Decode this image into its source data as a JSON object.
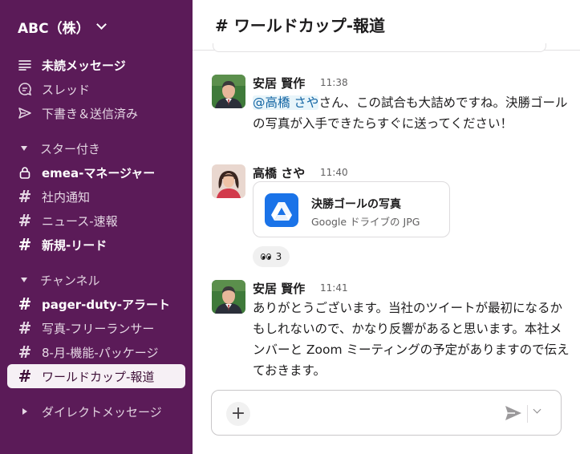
{
  "workspace": {
    "name": "ABC（株）"
  },
  "sidebar": {
    "nav": [
      {
        "label": "未読メッセージ",
        "icon": "unread-lines-icon"
      },
      {
        "label": "スレッド",
        "icon": "thread-bubble-icon"
      },
      {
        "label": "下書き＆送信済み",
        "icon": "send-arrow-icon"
      }
    ],
    "starred_section": "スター付き",
    "starred": [
      {
        "label": "emea-マネージャー",
        "icon": "lock-icon"
      },
      {
        "label": "社内通知",
        "icon": "hash-icon"
      },
      {
        "label": "ニュース-速報",
        "icon": "hash-icon"
      },
      {
        "label": "新規-リード",
        "icon": "hash-icon"
      }
    ],
    "channels_section": "チャンネル",
    "channels": [
      {
        "label": "pager-duty-アラート",
        "icon": "hash-icon"
      },
      {
        "label": "写真-フリーランサー",
        "icon": "hash-icon"
      },
      {
        "label": "8-月-機能-パッケージ",
        "icon": "hash-icon"
      },
      {
        "label": "ワールドカップ-報道",
        "icon": "hash-icon",
        "active": true
      }
    ],
    "dm_section": "ダイレクトメッセージ"
  },
  "header": {
    "hash": "#",
    "channel": "ワールドカップ-報道"
  },
  "messages": [
    {
      "author": "安居 賢作",
      "time": "11:38",
      "mention": "@高橋 さや",
      "text": "さん、この試合も大詰めですね。決勝ゴールの写真が入手できたらすぐに送ってください！"
    },
    {
      "author": "高橋 さや",
      "time": "11:40",
      "file": {
        "name": "決勝ゴールの写真",
        "meta": "Google ドライブの JPG",
        "icon": "google-drive-icon"
      },
      "reaction": {
        "emoji": "eyes",
        "count": "3"
      }
    },
    {
      "author": "安居 賢作",
      "time": "11:41",
      "text": "ありがとうございます。当社のツイートが最初になるかもしれないので、かなり反響があると思います。本社メンバーと Zoom ミーティングの予定がありますので伝えておきます。"
    }
  ],
  "composer": {
    "placeholder": ""
  },
  "colors": {
    "sidebar": "#5b1b58",
    "active_item": "#f6f0f5",
    "mention": "#1264a3",
    "drive_blue": "#1a73e8"
  }
}
